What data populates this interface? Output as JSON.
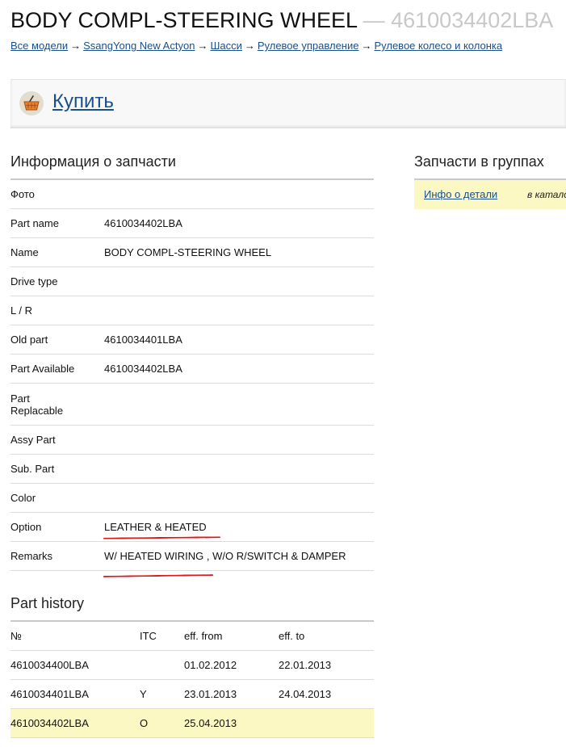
{
  "page": {
    "title": "BODY COMPL-STEERING WHEEL",
    "separator": "—",
    "part_code": "4610034402LBA"
  },
  "breadcrumb": {
    "items": [
      "Все модели",
      "SsangYong New Actyon",
      "Шасси",
      "Рулевое управление",
      "Рулевое колесо и колонка"
    ],
    "arrow": "→"
  },
  "buy": {
    "label": "Купить",
    "icon": "basket-icon"
  },
  "info": {
    "heading": "Информация о запчасти",
    "rows": [
      {
        "label": "Фото",
        "value": ""
      },
      {
        "label": "Part name",
        "value": "4610034402LBA"
      },
      {
        "label": "Name",
        "value": "BODY COMPL-STEERING WHEEL"
      },
      {
        "label": "Drive type",
        "value": ""
      },
      {
        "label": "L / R",
        "value": ""
      },
      {
        "label": "Old part",
        "value": "4610034401LBA"
      },
      {
        "label": "Part Available",
        "value": "4610034402LBA"
      },
      {
        "label": "Part Replacable",
        "value": ""
      },
      {
        "label": "Assy Part",
        "value": ""
      },
      {
        "label": "Sub. Part",
        "value": ""
      },
      {
        "label": "Color",
        "value": ""
      },
      {
        "label": "Option",
        "value": "LEATHER & HEATED"
      },
      {
        "label": "Remarks",
        "value": "W/ HEATED WIRING , W/O R/SWITCH & DAMPER"
      }
    ]
  },
  "history": {
    "heading": "Part history",
    "columns": [
      "№",
      "ITC",
      "eff. from",
      "eff. to"
    ],
    "rows": [
      {
        "no": "4610034400LBA",
        "itc": "",
        "from": "01.02.2012",
        "to": "22.01.2013"
      },
      {
        "no": "4610034401LBA",
        "itc": "Y",
        "from": "23.01.2013",
        "to": "24.04.2013"
      },
      {
        "no": "4610034402LBA",
        "itc": "O",
        "from": "25.04.2013",
        "to": ""
      }
    ]
  },
  "groups": {
    "heading": "Запчасти в группах",
    "link": "Инфо о детали",
    "catalog_text": "в каталоге"
  },
  "colors": {
    "link": "#1a4f8b",
    "highlight_row": "#fbf8c4",
    "annotation_red": "#e0161b"
  }
}
